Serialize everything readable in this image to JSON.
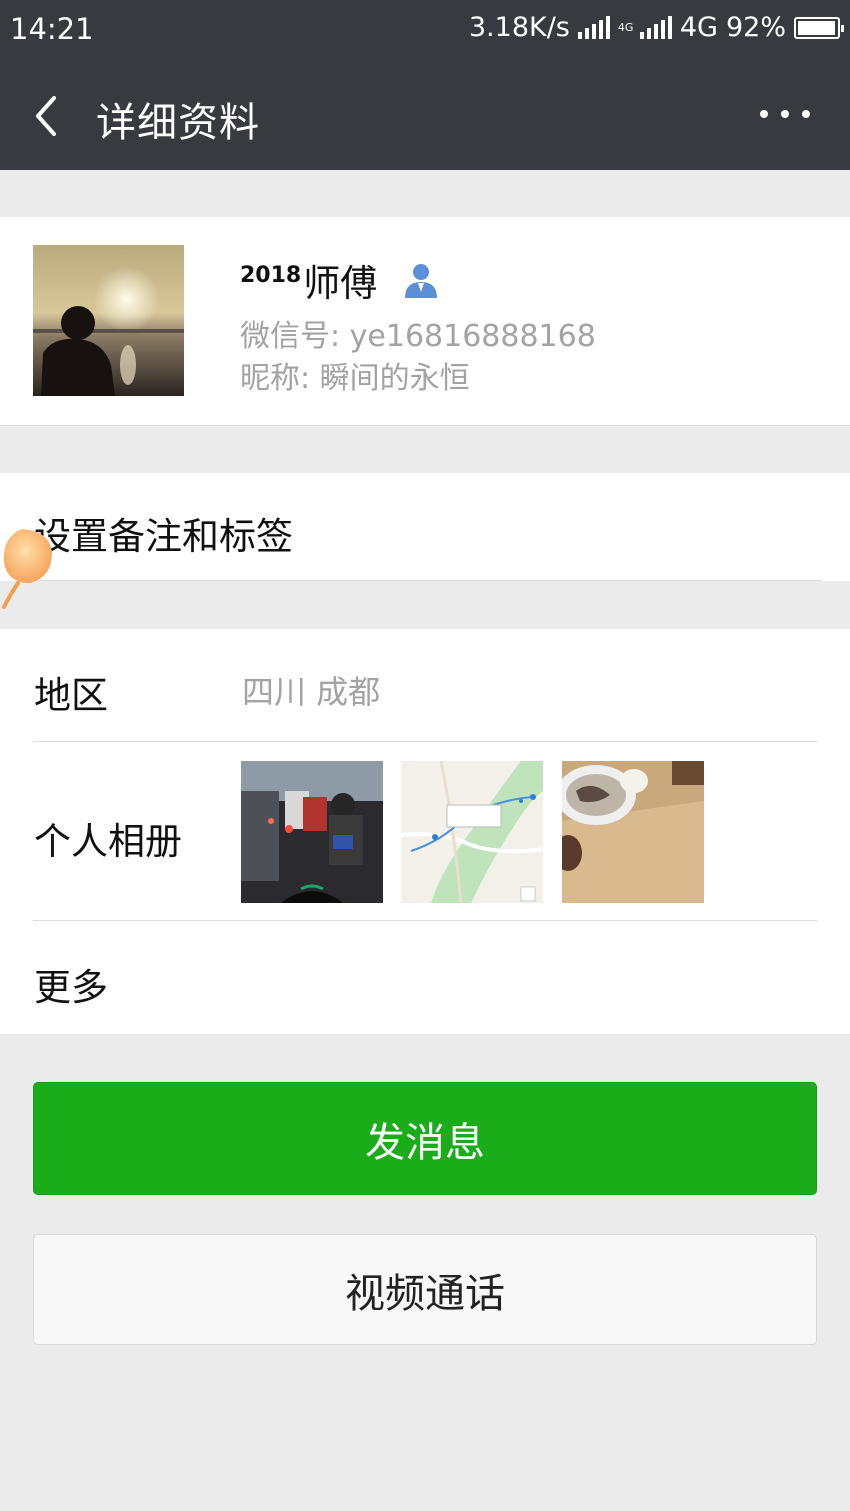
{
  "status_bar": {
    "time": "14:21",
    "speed": "3.18K/s",
    "mini_network": "4G",
    "network": "4G",
    "battery": "92%"
  },
  "header": {
    "title": "详细资料",
    "back_icon": "chevron-left-icon",
    "more_icon": "ellipsis-icon"
  },
  "profile": {
    "name_prefix": "2018",
    "name": "师傅",
    "contact_icon": "person-icon",
    "wechat_id": "微信号: ye16816888168",
    "nickname": "昵称: 瞬间的永恒"
  },
  "remark": {
    "label": "设置备注和标签"
  },
  "details": {
    "region_label": "地区",
    "region_value": "四川  成都",
    "album_label": "个人相册",
    "more_label": "更多"
  },
  "actions": {
    "send_message": "发消息",
    "video_call": "视频通话"
  },
  "colors": {
    "header_bg": "#393a3f",
    "primary_green": "#1aad19",
    "page_bg": "#ebebeb",
    "secondary_text": "#a3a3a3"
  }
}
